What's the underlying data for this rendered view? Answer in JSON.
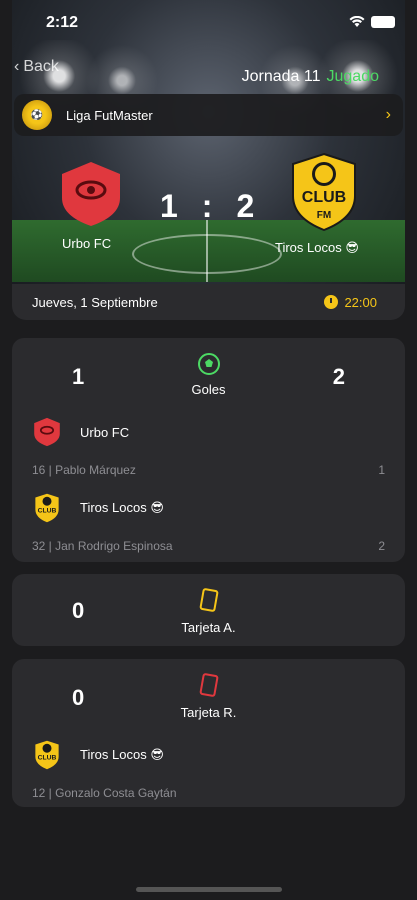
{
  "status_bar": {
    "time": "2:12"
  },
  "nav": {
    "back_label": "Back",
    "round_label": "Jornada 11",
    "state_label": "Jugado"
  },
  "league": {
    "name": "Liga FutMaster"
  },
  "match": {
    "home_team": "Urbo FC",
    "away_team": "Tiros Locos 😎",
    "home_score": "1",
    "separator": ":",
    "away_score": "2",
    "date": "Jueves, 1 Septiembre",
    "kickoff": "22:00"
  },
  "stats": {
    "goals": {
      "label": "Goles",
      "home": "1",
      "away": "2",
      "events": [
        {
          "team": "Urbo FC",
          "player": "16 | Pablo Márquez",
          "count": "1"
        },
        {
          "team": "Tiros Locos 😎",
          "player": "32 | Jan Rodrigo Espinosa",
          "count": "2"
        }
      ]
    },
    "yellow_cards": {
      "label": "Tarjeta A.",
      "home": "0"
    },
    "red_cards": {
      "label": "Tarjeta R.",
      "home": "0",
      "events": [
        {
          "team": "Tiros Locos 😎",
          "player": "12 | Gonzalo Costa Gaytán"
        }
      ]
    }
  },
  "colors": {
    "accent": "#f5c518",
    "played": "#4cd964",
    "home_crest": "#e0383e",
    "card_bg": "#2b2b2e"
  },
  "icons": {
    "ball": "soccer-ball-icon",
    "yellow_card": "yellow-card-icon",
    "red_card": "red-card-icon",
    "clock": "clock-icon"
  }
}
